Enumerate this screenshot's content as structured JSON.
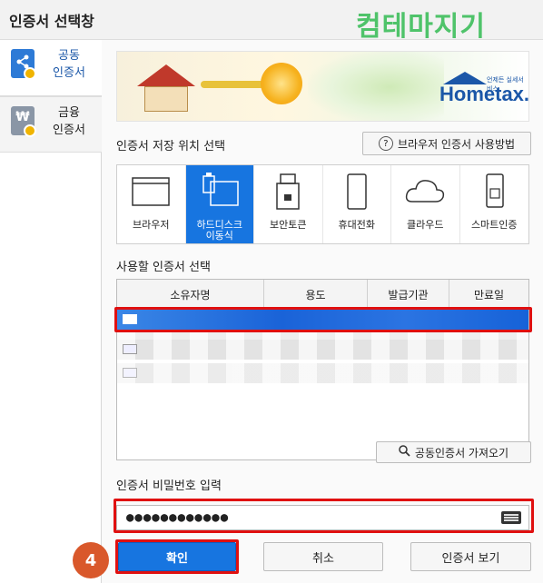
{
  "window": {
    "title": "인증서 선택창"
  },
  "watermark": "컴테마지기",
  "sidebar": {
    "items": [
      {
        "label": "공동\n인증서",
        "icon": "share-icon",
        "color": "#2d7ad6",
        "active": true
      },
      {
        "label": "금융\n인증서",
        "icon": "won-icon",
        "color": "#8a96a6",
        "active": false
      }
    ]
  },
  "banner": {
    "brand": "Hometax.",
    "brand_tagline": "언제든 실세서비스"
  },
  "storage": {
    "heading": "인증서 저장 위치 선택",
    "help_button": "브라우저 인증서 사용방법",
    "options": [
      {
        "label": "브라우저",
        "icon": "browser-icon"
      },
      {
        "label": "하드디스크\n이동식",
        "icon": "usb-drive-icon",
        "selected": true
      },
      {
        "label": "보안토큰",
        "icon": "security-token-icon"
      },
      {
        "label": "휴대전화",
        "icon": "mobile-phone-icon"
      },
      {
        "label": "클라우드",
        "icon": "cloud-icon"
      },
      {
        "label": "스마트인증",
        "icon": "smart-card-icon"
      }
    ]
  },
  "cert_list": {
    "heading": "사용할 인증서 선택",
    "columns": [
      "소유자명",
      "용도",
      "발급기관",
      "만료일"
    ],
    "import_button": "공동인증서 가져오기"
  },
  "password": {
    "label": "인증서 비밀번호 입력",
    "value": "●●●●●●●●●●●●"
  },
  "actions": {
    "ok": "확인",
    "cancel": "취소",
    "view": "인증서 보기"
  },
  "step_badge": "4",
  "colors": {
    "accent": "#1775e0",
    "highlight": "#e01010",
    "badge": "#d9582b"
  }
}
